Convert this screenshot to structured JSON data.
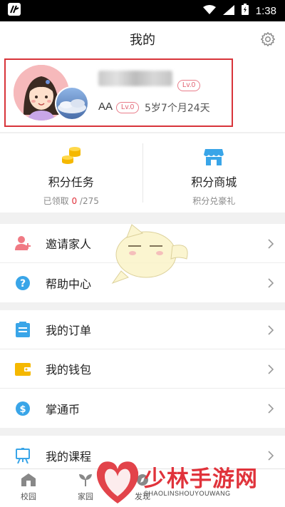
{
  "status_bar": {
    "time": "1:38"
  },
  "header": {
    "title": "我的"
  },
  "profile": {
    "child_name": "AA",
    "level_top": "Lv.0",
    "level_child": "Lv.0",
    "age": "5岁7个月24天"
  },
  "points": {
    "task": {
      "title": "积分任务",
      "sub_prefix": "已领取 ",
      "claimed": "0",
      "sub_suffix": " /275"
    },
    "mall": {
      "title": "积分商城",
      "sub": "积分兑豪礼"
    }
  },
  "menu_group_1": [
    {
      "label": "邀请家人",
      "icon": "add-user-icon"
    },
    {
      "label": "帮助中心",
      "icon": "help-icon"
    }
  ],
  "menu_group_2": [
    {
      "label": "我的订单",
      "icon": "order-icon"
    },
    {
      "label": "我的钱包",
      "icon": "wallet-icon"
    },
    {
      "label": "掌通币",
      "icon": "coin-icon"
    }
  ],
  "menu_group_3": [
    {
      "label": "我的课程",
      "icon": "course-icon"
    }
  ],
  "tabbar": [
    {
      "label": "校园",
      "icon": "school-icon"
    },
    {
      "label": "家园",
      "icon": "sprout-icon"
    },
    {
      "label": "发现",
      "icon": "discover-icon"
    }
  ],
  "watermark": {
    "text": "少林手游网",
    "sub": "SHAOLINSHOUYOUWANG"
  },
  "colors": {
    "accent_red": "#d8343a",
    "badge_pink": "#e0606f",
    "icon_blue": "#39a5e8",
    "icon_yellow": "#f5b800"
  }
}
